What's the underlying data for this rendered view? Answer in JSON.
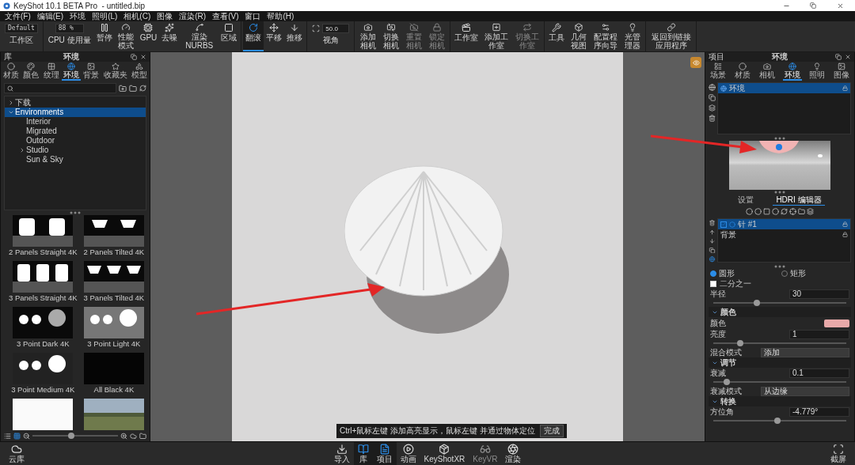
{
  "window": {
    "title": "KeyShot 10.1 BETA Pro  - untitled.bip"
  },
  "menu": [
    "文件(F)",
    "编辑(E)",
    "环境",
    "照明(L)",
    "相机(C)",
    "图像",
    "渲染(R)",
    "查看(V)",
    "窗口",
    "帮助(H)"
  ],
  "toolbar": {
    "groups": [
      [
        {
          "kind": "dropdown",
          "value": "Default",
          "label": "工作区"
        }
      ],
      [
        {
          "kind": "dropdown",
          "value": "88 %",
          "label": "CPU 使用量"
        },
        {
          "kind": "button",
          "label": "暂停",
          "selected": false,
          "disabled": false
        },
        {
          "kind": "button",
          "label": "性能模式",
          "selected": false,
          "disabled": false
        },
        {
          "kind": "button",
          "label": "GPU",
          "selected": false,
          "disabled": false
        },
        {
          "kind": "button",
          "label": "去噪",
          "selected": false,
          "disabled": false
        },
        {
          "kind": "button",
          "label": "渲染 NURBS",
          "selected": false,
          "disabled": false
        },
        {
          "kind": "button",
          "label": "区域",
          "selected": false,
          "disabled": false
        }
      ],
      [
        {
          "kind": "button",
          "label": "翻滚",
          "selected": true,
          "disabled": false
        },
        {
          "kind": "button",
          "label": "平移",
          "selected": false,
          "disabled": false
        },
        {
          "kind": "button",
          "label": "推移",
          "selected": false,
          "disabled": false
        }
      ],
      [
        {
          "kind": "field",
          "value": "50.0",
          "label": "视角"
        }
      ],
      [
        {
          "kind": "button",
          "label": "添加相机",
          "selected": false,
          "disabled": false
        },
        {
          "kind": "button",
          "label": "切换相机",
          "selected": false,
          "disabled": false
        },
        {
          "kind": "button",
          "label": "重置相机",
          "selected": false,
          "disabled": true
        },
        {
          "kind": "button",
          "label": "锁定相机",
          "selected": false,
          "disabled": true
        }
      ],
      [
        {
          "kind": "button",
          "label": "工作室",
          "selected": false,
          "disabled": false
        },
        {
          "kind": "button",
          "label": "添加工作室",
          "selected": false,
          "disabled": false
        },
        {
          "kind": "button",
          "label": "切换工作室",
          "selected": false,
          "disabled": true
        }
      ],
      [
        {
          "kind": "button",
          "label": "工具",
          "selected": false,
          "disabled": false
        },
        {
          "kind": "button",
          "label": "几何视图",
          "selected": false,
          "disabled": false
        },
        {
          "kind": "button",
          "label": "配置程序向导",
          "selected": false,
          "disabled": false
        },
        {
          "kind": "button",
          "label": "光管理器",
          "selected": false,
          "disabled": false
        }
      ],
      [
        {
          "kind": "button",
          "label": "返回到链接应用程序",
          "selected": false,
          "disabled": false
        }
      ]
    ]
  },
  "library": {
    "title": "库",
    "heading": "环境",
    "tabs": [
      {
        "label": "材质",
        "selected": false
      },
      {
        "label": "颜色",
        "selected": false
      },
      {
        "label": "纹理",
        "selected": false
      },
      {
        "label": "环境",
        "selected": true
      },
      {
        "label": "背景",
        "selected": false
      },
      {
        "label": "收藏夹",
        "selected": false
      },
      {
        "label": "模型",
        "selected": false
      }
    ],
    "tree": [
      {
        "label": "下载",
        "expanded": false,
        "selected": false
      },
      {
        "label": "Environments",
        "expanded": true,
        "selected": true,
        "children": [
          {
            "label": "Interior",
            "selected": false
          },
          {
            "label": "Migrated",
            "selected": false
          },
          {
            "label": "Outdoor",
            "selected": false
          },
          {
            "label": "Studio",
            "expanded": false,
            "selected": false
          },
          {
            "label": "Sun & Sky",
            "selected": false
          }
        ]
      }
    ],
    "thumbnails": [
      {
        "label": "2 Panels Straight 4K",
        "kind": "panels-straight-2"
      },
      {
        "label": "2 Panels Tilted 4K",
        "kind": "panels-tilted-2"
      },
      {
        "label": "3 Panels Straight 4K",
        "kind": "panels-straight-3"
      },
      {
        "label": "3 Panels Tilted 4K",
        "kind": "panels-tilted-3"
      },
      {
        "label": "3 Point Dark 4K",
        "kind": "points-dark"
      },
      {
        "label": "3 Point Light 4K",
        "kind": "points-light"
      },
      {
        "label": "3 Point Medium 4K",
        "kind": "points-medium"
      },
      {
        "label": "All Black 4K",
        "kind": "black"
      },
      {
        "kind": "white"
      },
      {
        "kind": "landscape"
      }
    ],
    "zoom": {
      "level": 0.45
    }
  },
  "viewport": {
    "hint": {
      "text": "Ctrl+鼠标左键 添加高亮显示，鼠标左键 并通过物体定位",
      "button": "完成"
    }
  },
  "project": {
    "title": "项目",
    "heading": "环境",
    "tabs": [
      {
        "label": "场景",
        "selected": false
      },
      {
        "label": "材质",
        "selected": false
      },
      {
        "label": "相机",
        "selected": false
      },
      {
        "label": "环境",
        "selected": true
      },
      {
        "label": "照明",
        "selected": false
      },
      {
        "label": "图像",
        "selected": false
      }
    ],
    "environments": [
      {
        "label": "环境",
        "selected": true
      }
    ],
    "editor_tabs": [
      {
        "label": "设置",
        "selected": false
      },
      {
        "label": "HDRI 编辑器",
        "selected": true
      }
    ],
    "pins": [
      {
        "kind": "pin",
        "label": "针 #1",
        "checked": true,
        "selected": true
      },
      {
        "kind": "background",
        "label": "背景",
        "selected": false
      }
    ],
    "shapes": [
      {
        "label": "圆形",
        "selected": true
      },
      {
        "label": "矩形",
        "selected": false
      }
    ],
    "half": {
      "label": "二分之一",
      "checked": false
    },
    "rows": [
      {
        "kind": "slider",
        "label": "半径",
        "value": "30",
        "level": 0.33
      }
    ],
    "sections": [
      {
        "title": "颜色",
        "expanded": true,
        "rows": [
          {
            "kind": "color",
            "label": "颜色",
            "color": "#e8a9a9"
          },
          {
            "kind": "slider",
            "label": "亮度",
            "value": "1",
            "level": 0.2
          },
          {
            "kind": "select",
            "label": "混合模式",
            "value": "添加"
          }
        ]
      },
      {
        "title": "调节",
        "expanded": true,
        "rows": [
          {
            "kind": "slider",
            "label": "衰减",
            "value": "0.1",
            "level": 0.1
          },
          {
            "kind": "select",
            "label": "衰减模式",
            "value": "从边缘"
          }
        ]
      },
      {
        "title": "转换",
        "expanded": true,
        "rows": [
          {
            "kind": "slider",
            "label": "方位角",
            "value": "-4.779°",
            "level": 0.48
          }
        ]
      }
    ]
  },
  "dock": {
    "left": "云库",
    "right": "截屏",
    "items": [
      {
        "label": "导入",
        "selected": false,
        "disabled": false
      },
      {
        "label": "库",
        "selected": true,
        "disabled": false
      },
      {
        "label": "项目",
        "selected": true,
        "disabled": false
      },
      {
        "label": "动画",
        "selected": false,
        "disabled": false
      },
      {
        "label": "KeyShotXR",
        "selected": false,
        "disabled": false
      },
      {
        "label": "KeyVR",
        "selected": false,
        "disabled": true
      },
      {
        "label": "渲染",
        "selected": false,
        "disabled": false
      }
    ]
  }
}
